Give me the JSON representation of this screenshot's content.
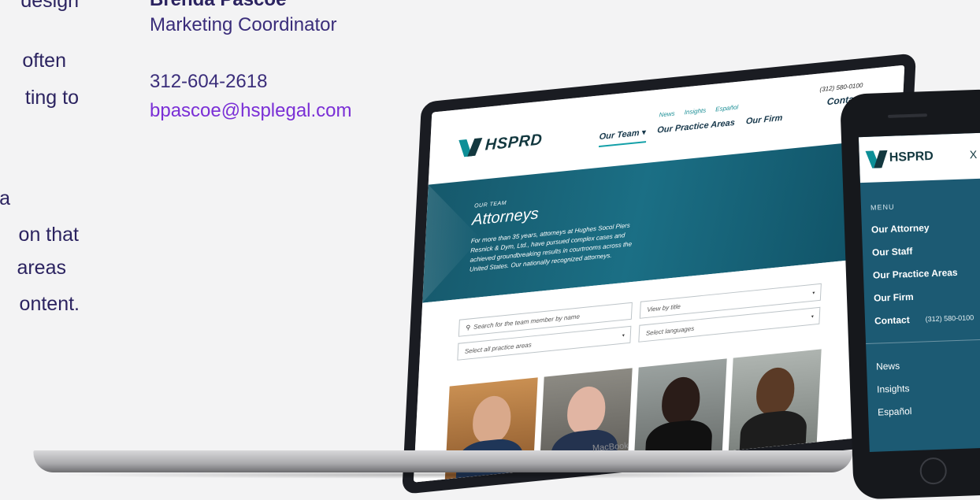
{
  "left_text": {
    "lines": [
      "design",
      "often",
      "ting to",
      "a",
      "on that",
      "areas",
      "ontent."
    ]
  },
  "contact": {
    "name": "Brenda Pascoe",
    "role": "Marketing Coordinator",
    "phone": "312-604-2618",
    "email": "bpascoe@hsplegal.com"
  },
  "laptop": {
    "label": "MacBook",
    "site": {
      "logo": "HSPRD",
      "utility_nav": [
        "News",
        "Insights",
        "Español"
      ],
      "main_nav": [
        "Our Team ▾",
        "Our Practice Areas",
        "Our Firm"
      ],
      "phone": "(312) 580-0100",
      "contact": "Contact",
      "hero": {
        "eyebrow": "OUR TEAM",
        "title": "Attorneys",
        "description": "For more than 35 years, attorneys at Hughes Socol Piers Resnick & Dym, Ltd., have pursued complex cases and achieved groundbreaking results in courtrooms across the United States. Our nationally recognized attorneys."
      },
      "filters": {
        "search_placeholder": "Search for the team member by name",
        "title_placeholder": "View by title",
        "areas_placeholder": "Select all practice areas",
        "languages_placeholder": "Select languages"
      }
    }
  },
  "phone": {
    "logo": "HSPRD",
    "close": "X",
    "menu_label": "MENU",
    "nav": [
      "Our Attorney",
      "Our Staff",
      "Our Practice Areas",
      "Our Firm"
    ],
    "contact": "Contact",
    "contact_phone": "(312) 580-0100",
    "sub_nav": [
      "News",
      "Insights",
      "Español"
    ]
  },
  "colors": {
    "brand_teal": "#1c5a73",
    "text_purple": "#2b2360",
    "link_purple": "#7a2fd6"
  }
}
